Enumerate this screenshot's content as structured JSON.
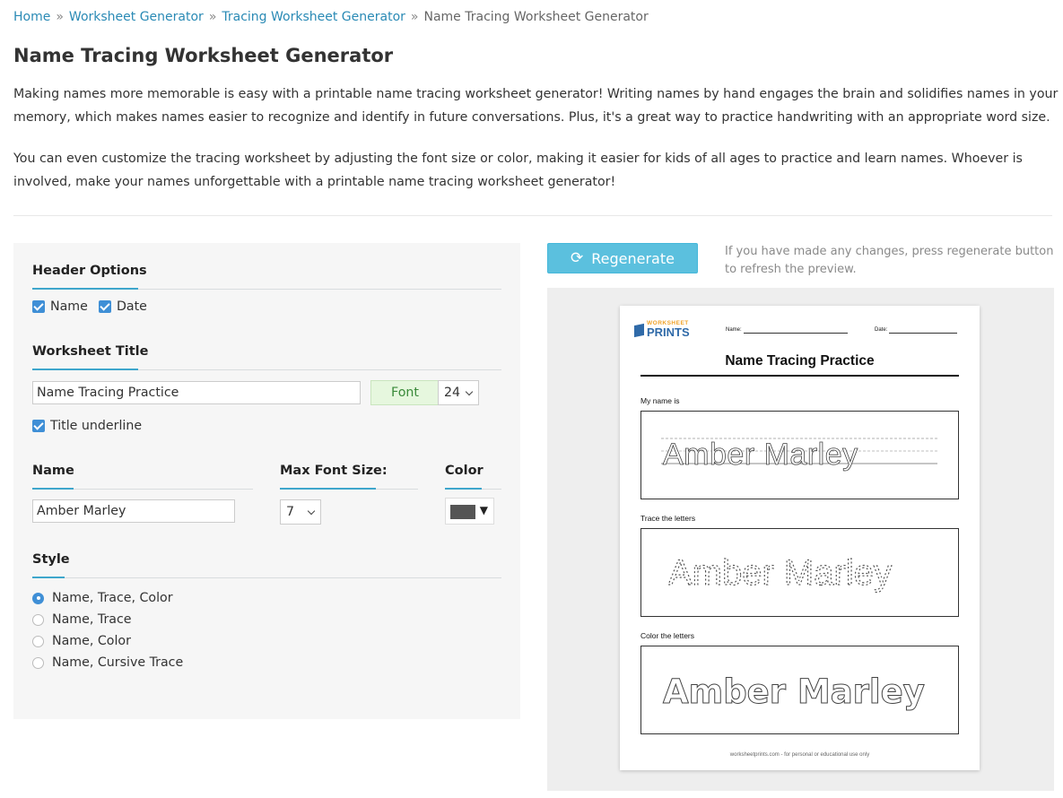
{
  "breadcrumb": {
    "home": "Home",
    "sep": "»",
    "worksheet_generator": "Worksheet Generator",
    "tracing_generator": "Tracing Worksheet Generator",
    "current": "Name Tracing Worksheet Generator"
  },
  "page_title": "Name Tracing Worksheet Generator",
  "intro": {
    "p1": "Making names more memorable is easy with a printable name tracing worksheet generator! Writing names by hand engages the brain and solidifies names in your memory, which makes names easier to recognize and identify in future conversations. Plus, it's a great way to practice handwriting with an appropriate word size.",
    "p2": "You can even customize the tracing worksheet by adjusting the font size or color, making it easier for kids of all ages to practice and learn names. Whoever is involved, make your names unforgettable with a printable name tracing worksheet generator!"
  },
  "options": {
    "header_options": {
      "heading": "Header Options",
      "name_label": "Name",
      "name_checked": true,
      "date_label": "Date",
      "date_checked": true
    },
    "worksheet_title": {
      "heading": "Worksheet Title",
      "value": "Name Tracing Practice",
      "font_button": "Font",
      "font_size": "24",
      "underline_label": "Title underline",
      "underline_checked": true
    },
    "name": {
      "heading": "Name",
      "value": "Amber Marley"
    },
    "max_font_size": {
      "heading": "Max Font Size:",
      "value": "7"
    },
    "color": {
      "heading": "Color",
      "value": "#555555",
      "dropdown_glyph": "▼"
    },
    "style": {
      "heading": "Style",
      "options": [
        {
          "label": "Name, Trace, Color",
          "selected": true
        },
        {
          "label": "Name, Trace",
          "selected": false
        },
        {
          "label": "Name, Color",
          "selected": false
        },
        {
          "label": "Name, Cursive Trace",
          "selected": false
        }
      ]
    }
  },
  "regenerate": {
    "icon": "refresh-icon",
    "glyph": "⟳",
    "label": "Regenerate",
    "note": "If you have made any changes, press regenerate button to refresh the preview."
  },
  "preview": {
    "logo_top": "WORKSHEET",
    "logo_bottom": "PRINTS",
    "name_field": "Name:",
    "date_field": "Date:",
    "title": "Name Tracing Practice",
    "sections": [
      {
        "label": "My name is",
        "text": "Amber Marley",
        "style": "guided"
      },
      {
        "label": "Trace the letters",
        "text": "Amber Marley",
        "style": "dotted"
      },
      {
        "label": "Color the letters",
        "text": "Amber Marley",
        "style": "outline"
      }
    ],
    "footer": "worksheetprints.com - for personal or educational use only"
  }
}
